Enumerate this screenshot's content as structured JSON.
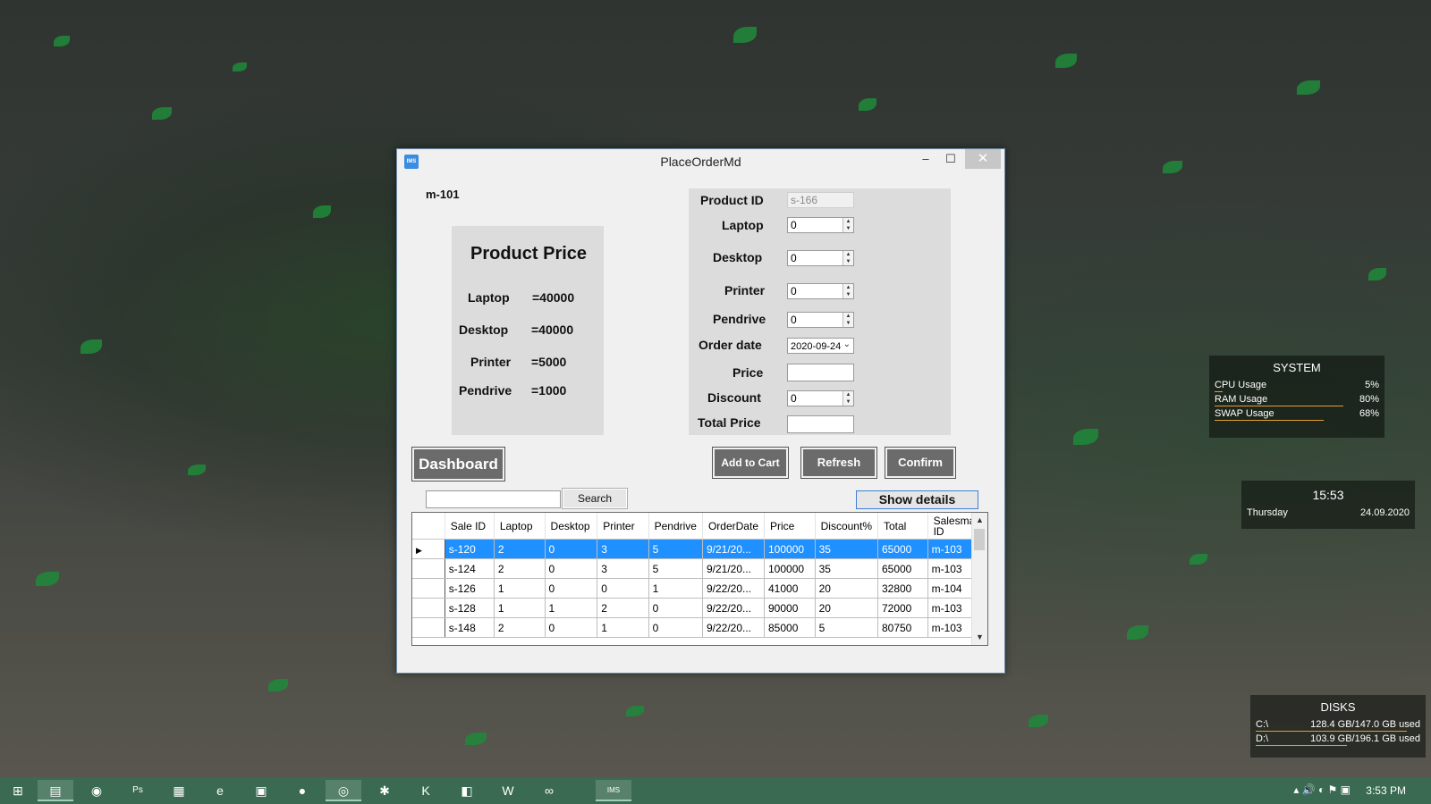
{
  "widgets": {
    "system": {
      "title": "SYSTEM",
      "rows": [
        {
          "label": "CPU Usage",
          "value": "5%",
          "level": 0.05
        },
        {
          "label": "RAM Usage",
          "value": "80%",
          "level": 0.8
        },
        {
          "label": "SWAP Usage",
          "value": "68%",
          "level": 0.68
        }
      ]
    },
    "clock": {
      "time": "15:53",
      "day": "Thursday",
      "date": "24.09.2020"
    },
    "disks": {
      "title": "DISKS",
      "rows": [
        {
          "label": "C:\\",
          "value": "128.4 GB/147.0 GB used"
        },
        {
          "label": "D:\\",
          "value": "103.9 GB/196.1 GB used"
        }
      ]
    }
  },
  "window": {
    "title": "PlaceOrderMd",
    "app_icon": "IMS",
    "controls": {
      "minimize": "‒",
      "maximize": "☐",
      "close": "✕"
    },
    "user_id": "m-101",
    "product_price": {
      "title": "Product Price",
      "rows": [
        {
          "name": "Laptop",
          "price": "=40000"
        },
        {
          "name": "Desktop",
          "price": "=40000"
        },
        {
          "name": "Printer",
          "price": "=5000"
        },
        {
          "name": "Pendrive",
          "price": "=1000"
        }
      ]
    },
    "form": {
      "product_id_label": "Product ID",
      "product_id_value": "s-166",
      "laptop_label": "Laptop",
      "laptop_value": "0",
      "desktop_label": "Desktop",
      "desktop_value": "0",
      "printer_label": "Printer",
      "printer_value": "0",
      "pendrive_label": "Pendrive",
      "pendrive_value": "0",
      "order_date_label": "Order date",
      "order_date_value": "2020-09-24",
      "price_label": "Price",
      "price_value": "",
      "discount_label": "Discount",
      "discount_value": "0",
      "total_price_label": "Total Price",
      "total_price_value": ""
    },
    "buttons": {
      "dashboard": "Dashboard",
      "add_to_cart": "Add to Cart",
      "refresh": "Refresh",
      "confirm": "Confirm",
      "search": "Search",
      "show_details": "Show details"
    },
    "search_value": "",
    "grid": {
      "columns": [
        "Sale ID",
        "Laptop",
        "Desktop",
        "Printer",
        "Pendrive",
        "OrderDate",
        "Price",
        "Discount%",
        "Total",
        "Salesman ID"
      ],
      "rows": [
        [
          "s-120",
          "2",
          "0",
          "3",
          "5",
          "9/21/20...",
          "100000",
          "35",
          "65000",
          "m-103"
        ],
        [
          "s-124",
          "2",
          "0",
          "3",
          "5",
          "9/21/20...",
          "100000",
          "35",
          "65000",
          "m-103"
        ],
        [
          "s-126",
          "1",
          "0",
          "0",
          "1",
          "9/22/20...",
          "41000",
          "20",
          "32800",
          "m-104"
        ],
        [
          "s-128",
          "1",
          "1",
          "2",
          "0",
          "9/22/20...",
          "90000",
          "20",
          "72000",
          "m-103"
        ],
        [
          "s-148",
          "2",
          "0",
          "1",
          "0",
          "9/22/20...",
          "85000",
          "5",
          "80750",
          "m-103"
        ]
      ],
      "selected_row": 0
    }
  },
  "taskbar": {
    "items": [
      "start-icon",
      "file-explorer-icon",
      "firefox-icon",
      "photoshop-icon",
      "store-icon",
      "ie-icon",
      "excel-icon",
      "media-icon",
      "chrome-icon",
      "app-icon",
      "kodi-icon",
      "app2-icon",
      "word-icon",
      "visual-studio-icon",
      "ims-icon"
    ],
    "clock": "3:53 PM"
  }
}
